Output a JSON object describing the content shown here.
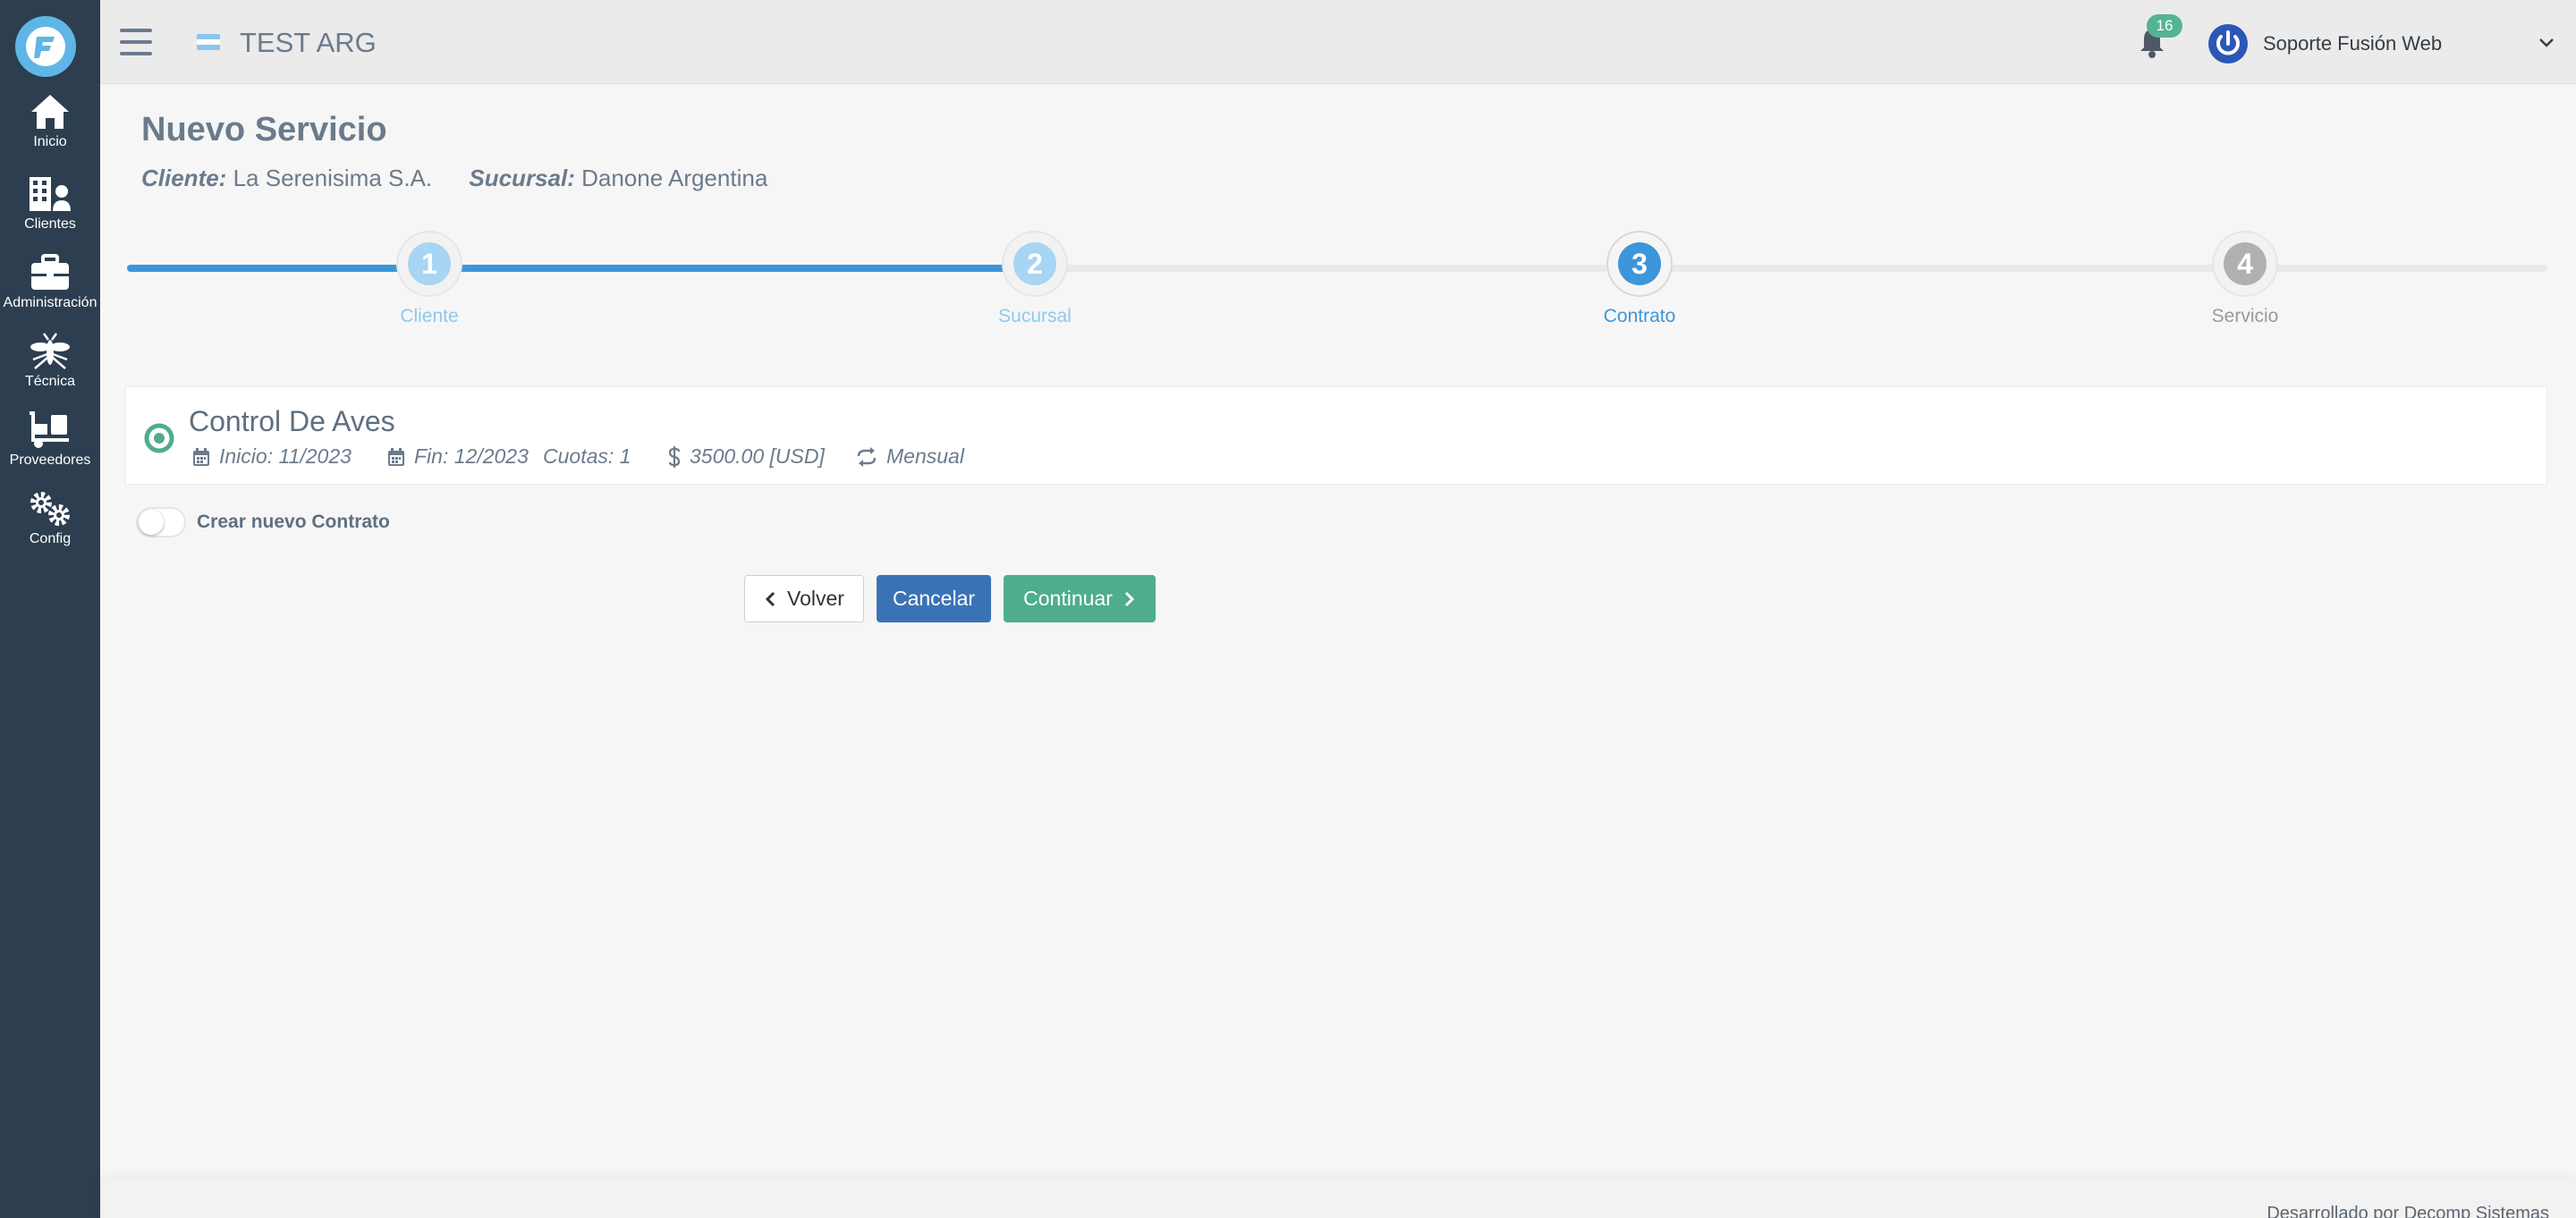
{
  "sidebar": {
    "items": [
      {
        "label": "Inicio",
        "icon": "home-icon"
      },
      {
        "label": "Clientes",
        "icon": "clients-icon"
      },
      {
        "label": "Administración",
        "icon": "briefcase-icon"
      },
      {
        "label": "Técnica",
        "icon": "mosquito-icon"
      },
      {
        "label": "Proveedores",
        "icon": "dolly-icon"
      },
      {
        "label": "Config",
        "icon": "gears-icon"
      }
    ]
  },
  "topbar": {
    "title": "TEST ARG",
    "notifications_count": "16",
    "user_name": "Soporte Fusión Web"
  },
  "page": {
    "title": "Nuevo Servicio",
    "cliente_label": "Cliente:",
    "cliente_value": "La Serenisima S.A.",
    "sucursal_label": "Sucursal:",
    "sucursal_value": "Danone Argentina"
  },
  "stepper": {
    "steps": [
      {
        "number": "1",
        "label": "Cliente",
        "state": "done"
      },
      {
        "number": "2",
        "label": "Sucursal",
        "state": "done"
      },
      {
        "number": "3",
        "label": "Contrato",
        "state": "active"
      },
      {
        "number": "4",
        "label": "Servicio",
        "state": "pending"
      }
    ],
    "progress_fraction": 0.38
  },
  "contract": {
    "name": "Control De Aves",
    "inicio": "Inicio: 11/2023",
    "fin": "Fin: 12/2023",
    "cuotas": "Cuotas: 1",
    "amount": "3500.00 [USD]",
    "frequency": "Mensual",
    "selected": true
  },
  "toggle": {
    "label": "Crear nuevo Contrato",
    "on": false
  },
  "buttons": {
    "back": "Volver",
    "cancel": "Cancelar",
    "continue": "Continuar"
  },
  "footer": {
    "text": "Desarrollado por Decomp Sistemas"
  },
  "colors": {
    "sidebar": "#2d3e50",
    "accent_blue": "#3d96d9",
    "step_done": "#a7d5f3",
    "step_pending": "#b0b0b0",
    "success_green": "#4ead8c",
    "cancel_blue": "#3a73b5"
  }
}
